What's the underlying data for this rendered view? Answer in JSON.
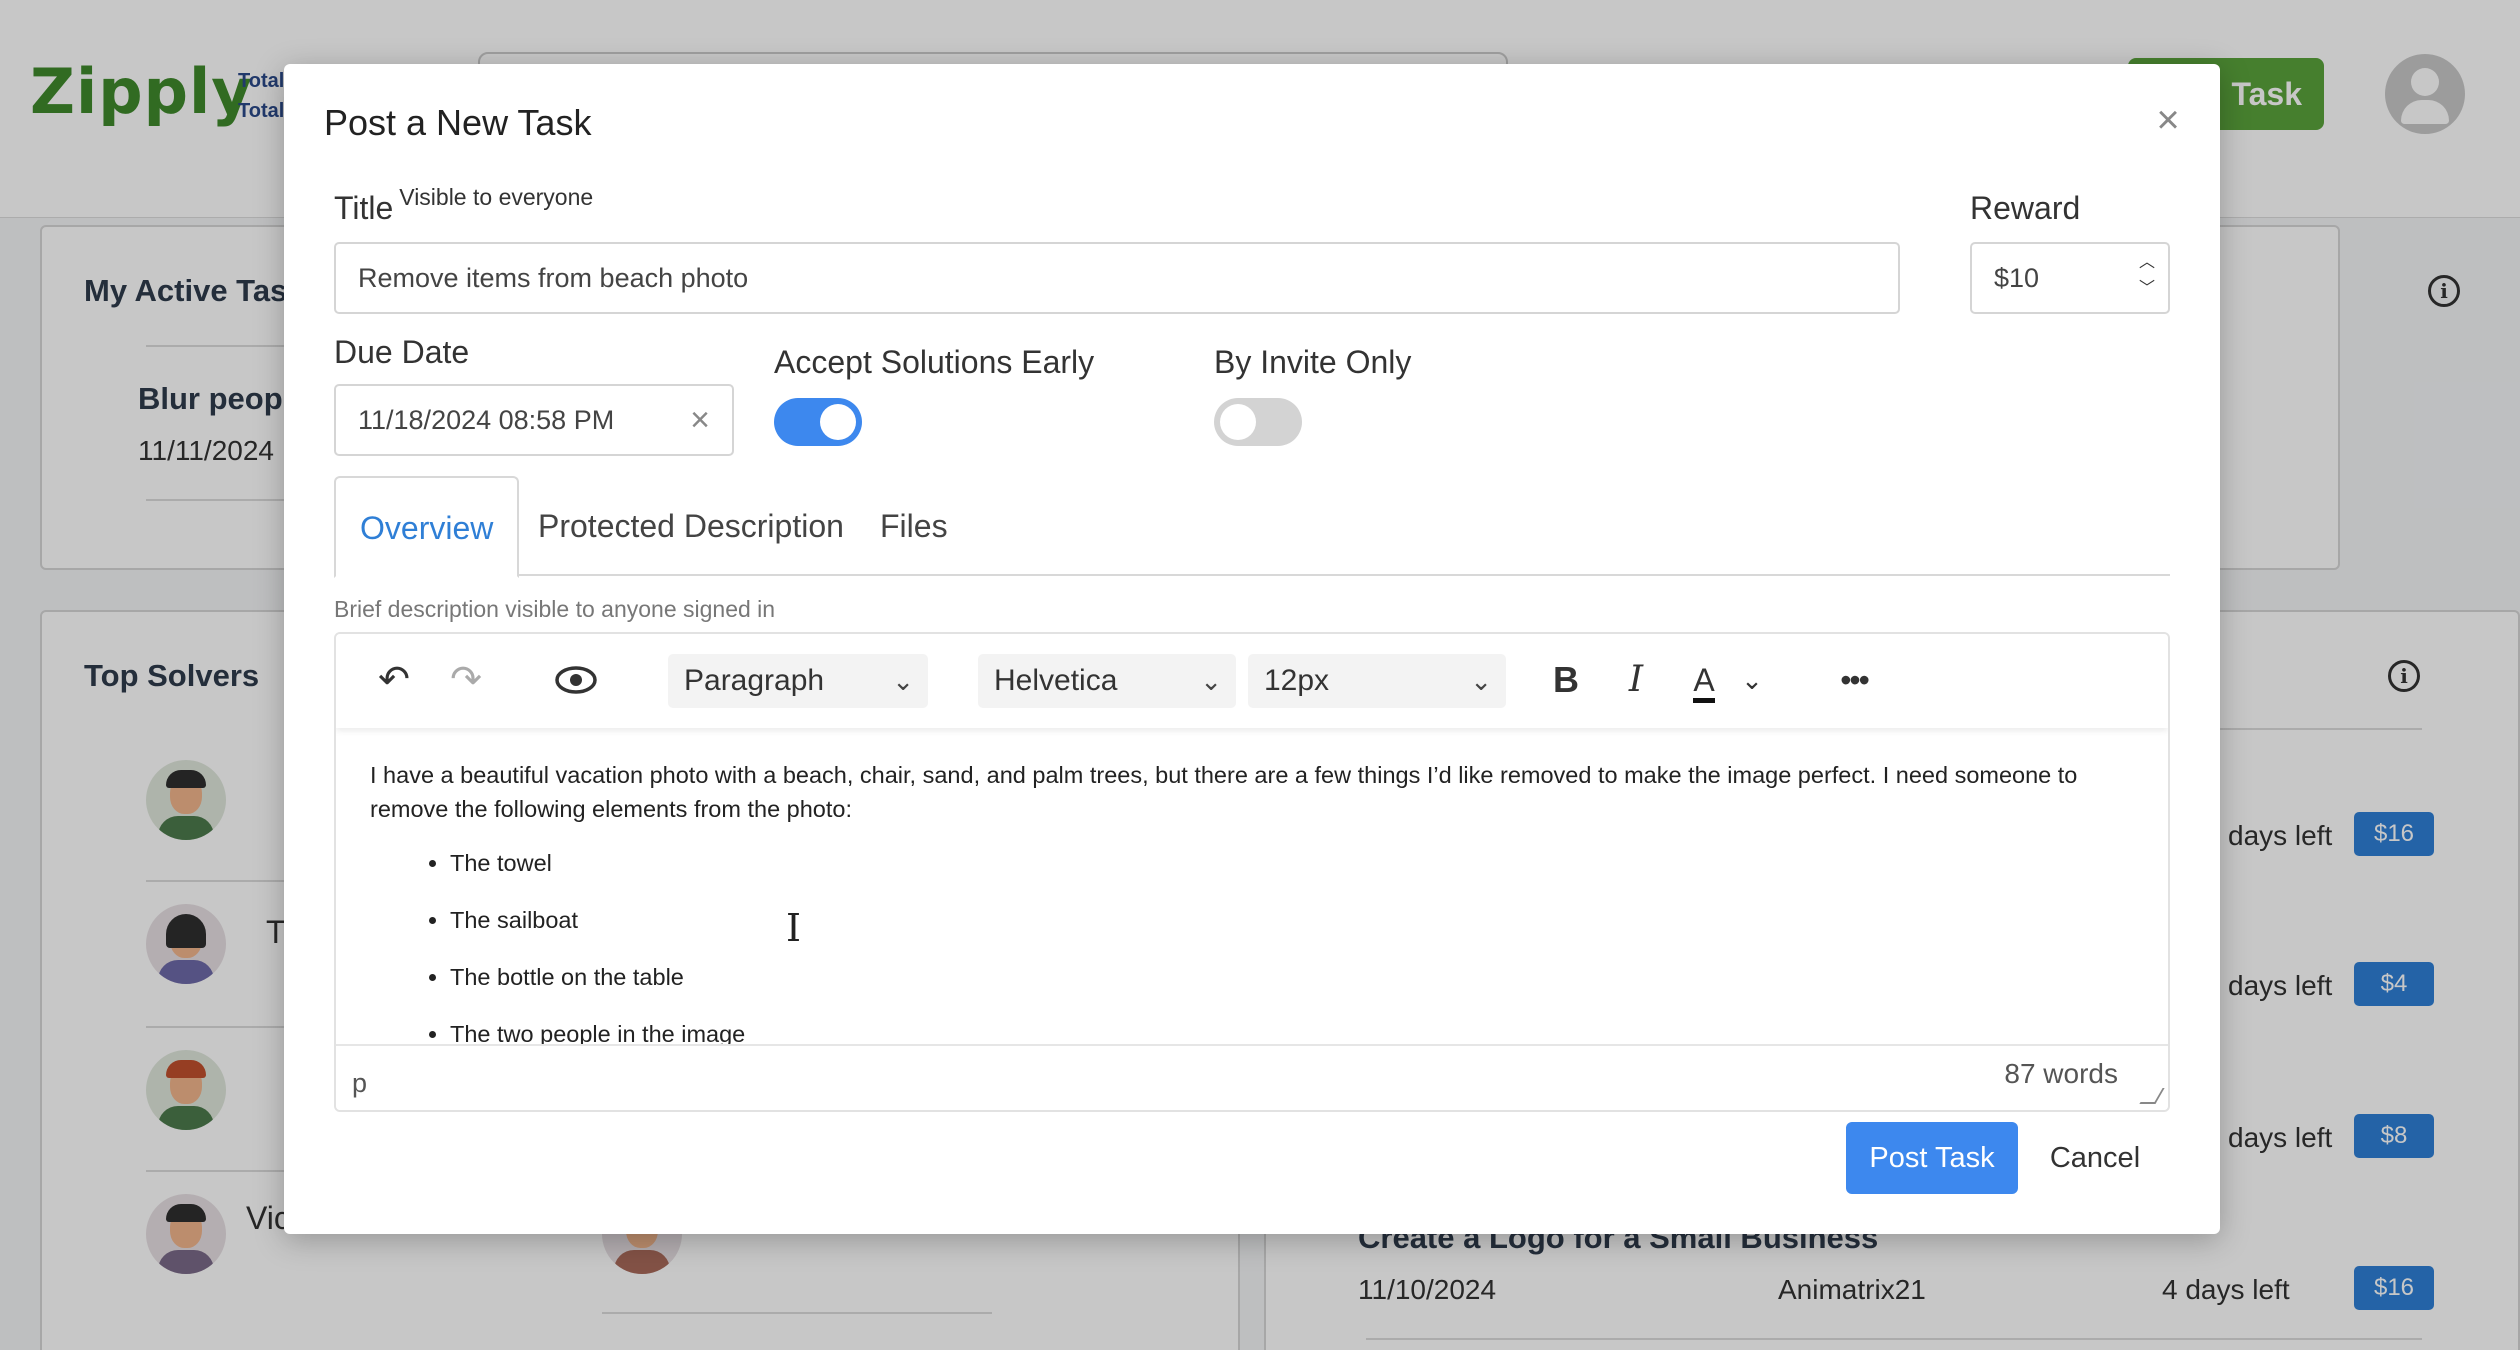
{
  "background": {
    "logo": "Zipply",
    "totals": [
      "Total",
      "Total"
    ],
    "new_task_label": "Task",
    "active_tasks": {
      "title": "My Active Tas",
      "task_title": "Blur peop",
      "task_date": "11/11/2024"
    },
    "top_solvers": {
      "title": "Top Solvers",
      "names": [
        "T",
        "Vic"
      ]
    },
    "task_rows": [
      {
        "days": "days left",
        "price": "$16"
      },
      {
        "days": "days left",
        "price": "$4"
      },
      {
        "days": "days left",
        "price": "$8"
      }
    ],
    "last_task": {
      "title": "Create a Logo for a Small Business",
      "date": "11/10/2024",
      "user": "Animatrix21",
      "days": "4 days left",
      "price": "$16"
    }
  },
  "modal": {
    "title": "Post a New Task",
    "close_icon": "close-icon",
    "title_label": "Title",
    "title_sublabel": "Visible to everyone",
    "title_value": "Remove items from beach photo",
    "reward_label": "Reward",
    "reward_value": "$10",
    "due_date_label": "Due Date",
    "due_date_value": "11/18/2024 08:58 PM",
    "accept_early_label": "Accept Solutions Early",
    "accept_early_on": true,
    "invite_only_label": "By Invite Only",
    "invite_only_on": false,
    "tabs": [
      {
        "label": "Overview",
        "active": true
      },
      {
        "label": "Protected Description",
        "active": false
      },
      {
        "label": "Files",
        "active": false
      }
    ],
    "hint": "Brief description visible to anyone signed in",
    "toolbar": {
      "block_format": "Paragraph",
      "font_family": "Helvetica",
      "font_size": "12px"
    },
    "content": {
      "paragraph": "I have a beautiful vacation photo with a beach, chair, sand, and palm trees, but there are a few things I’d like removed to make the image perfect. I need someone to remove the following elements from the photo:",
      "items": [
        "The towel",
        "The sailboat",
        "The bottle on the table",
        "The two people in the image"
      ]
    },
    "status_path": "p",
    "word_count": "87 words",
    "post_button": "Post Task",
    "cancel_button": "Cancel"
  },
  "colors": {
    "accent": "#3d88ee",
    "brand_green": "#3f8a2c",
    "badge_blue": "#2f7fd6"
  }
}
